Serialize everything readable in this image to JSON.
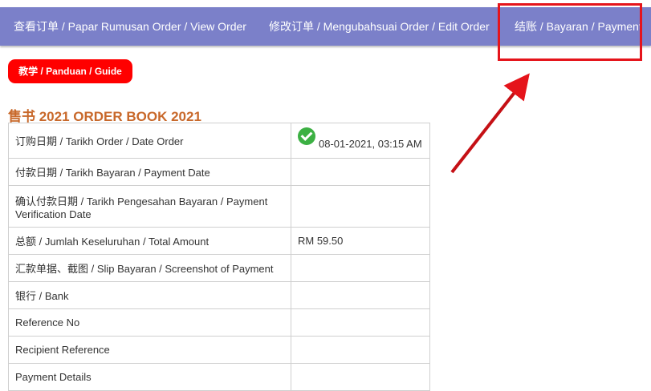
{
  "nav": {
    "view_order": "查看订单 / Papar Rumusan Order / View Order",
    "edit_order": "修改订单 / Mengubahsuai Order / Edit Order",
    "payment": "结账 / Bayaran / Payment"
  },
  "guide_button": "教学 / Panduan / Guide",
  "page_title": "售书 2021 ORDER BOOK 2021",
  "order_table": {
    "rows": [
      {
        "label": "订购日期 / Tarikh Order / Date Order",
        "value": "08-01-2021, 03:15 AM"
      },
      {
        "label": "付款日期 / Tarikh Bayaran / Payment Date",
        "value": ""
      },
      {
        "label": "确认付款日期 / Tarikh Pengesahan Bayaran / Payment Verification Date",
        "value": ""
      },
      {
        "label": "总额 / Jumlah Keseluruhan / Total Amount",
        "value": "RM 59.50"
      },
      {
        "label": "汇款单据、截图 / Slip Bayaran / Screenshot of Payment",
        "value": ""
      },
      {
        "label": "银行 / Bank",
        "value": ""
      },
      {
        "label": "Reference No",
        "value": ""
      },
      {
        "label": "Recipient Reference",
        "value": ""
      },
      {
        "label": "Payment Details",
        "value": ""
      }
    ]
  },
  "colors": {
    "nav_bg": "#7b80c9",
    "guide_bg": "#ff0000",
    "title": "#c8682a",
    "annotation": "#e5141b",
    "check": "#3cb043"
  },
  "icons": {
    "order_confirmed": "check-circle-icon"
  }
}
